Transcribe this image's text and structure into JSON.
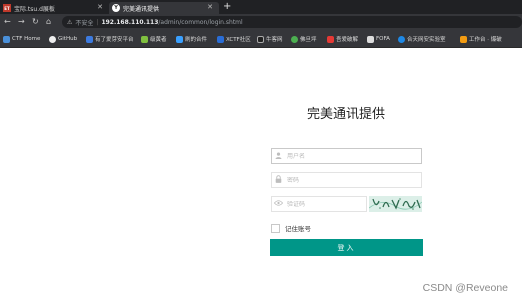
{
  "browser": {
    "tabs": [
      {
        "label": "宝际.tsu.d展板",
        "favicon": "ET"
      },
      {
        "label": "完美通讯提供",
        "favicon": "Y"
      }
    ],
    "new_tab": "+",
    "nav": {
      "back": "←",
      "forward": "→",
      "reload": "↻",
      "home": "⌂"
    },
    "address": {
      "security_label": "不安全",
      "host": "192.168.110.113",
      "path": "/admin/common/login.shtml"
    },
    "bookmarks": [
      {
        "label": "CTF Home",
        "color": "#4a90d9"
      },
      {
        "label": "GitHub",
        "color": "#eeeeee"
      },
      {
        "label": "有了爱芽安平台",
        "color": "#3d7be0"
      },
      {
        "label": "级黄者",
        "color": "#7fbf3f"
      },
      {
        "label": "刷的合件",
        "color": "#3aa0ff"
      },
      {
        "label": "XCTF社区",
        "color": "#2a6dd6"
      },
      {
        "label": "牛客网",
        "color": "#222222"
      },
      {
        "label": "佛旦坪",
        "color": "#4caf50"
      },
      {
        "label": "吾爱破解",
        "color": "#e53935"
      },
      {
        "label": "FOFA",
        "color": "#dddddd"
      },
      {
        "label": "合天网安实验室",
        "color": "#1e88e5"
      },
      {
        "label": "工作台 · 爆破",
        "color": "#f39c12"
      }
    ]
  },
  "login": {
    "title": "完美通讯提供",
    "username_placeholder": "用户名",
    "password_placeholder": "密码",
    "captcha_placeholder": "验证码",
    "remember_label": "记住账号",
    "submit_label": "登入"
  },
  "watermark": "CSDN @Reveone",
  "colors": {
    "primary": "#009688",
    "chrome_dark": "#202124",
    "chrome": "#35363a"
  }
}
